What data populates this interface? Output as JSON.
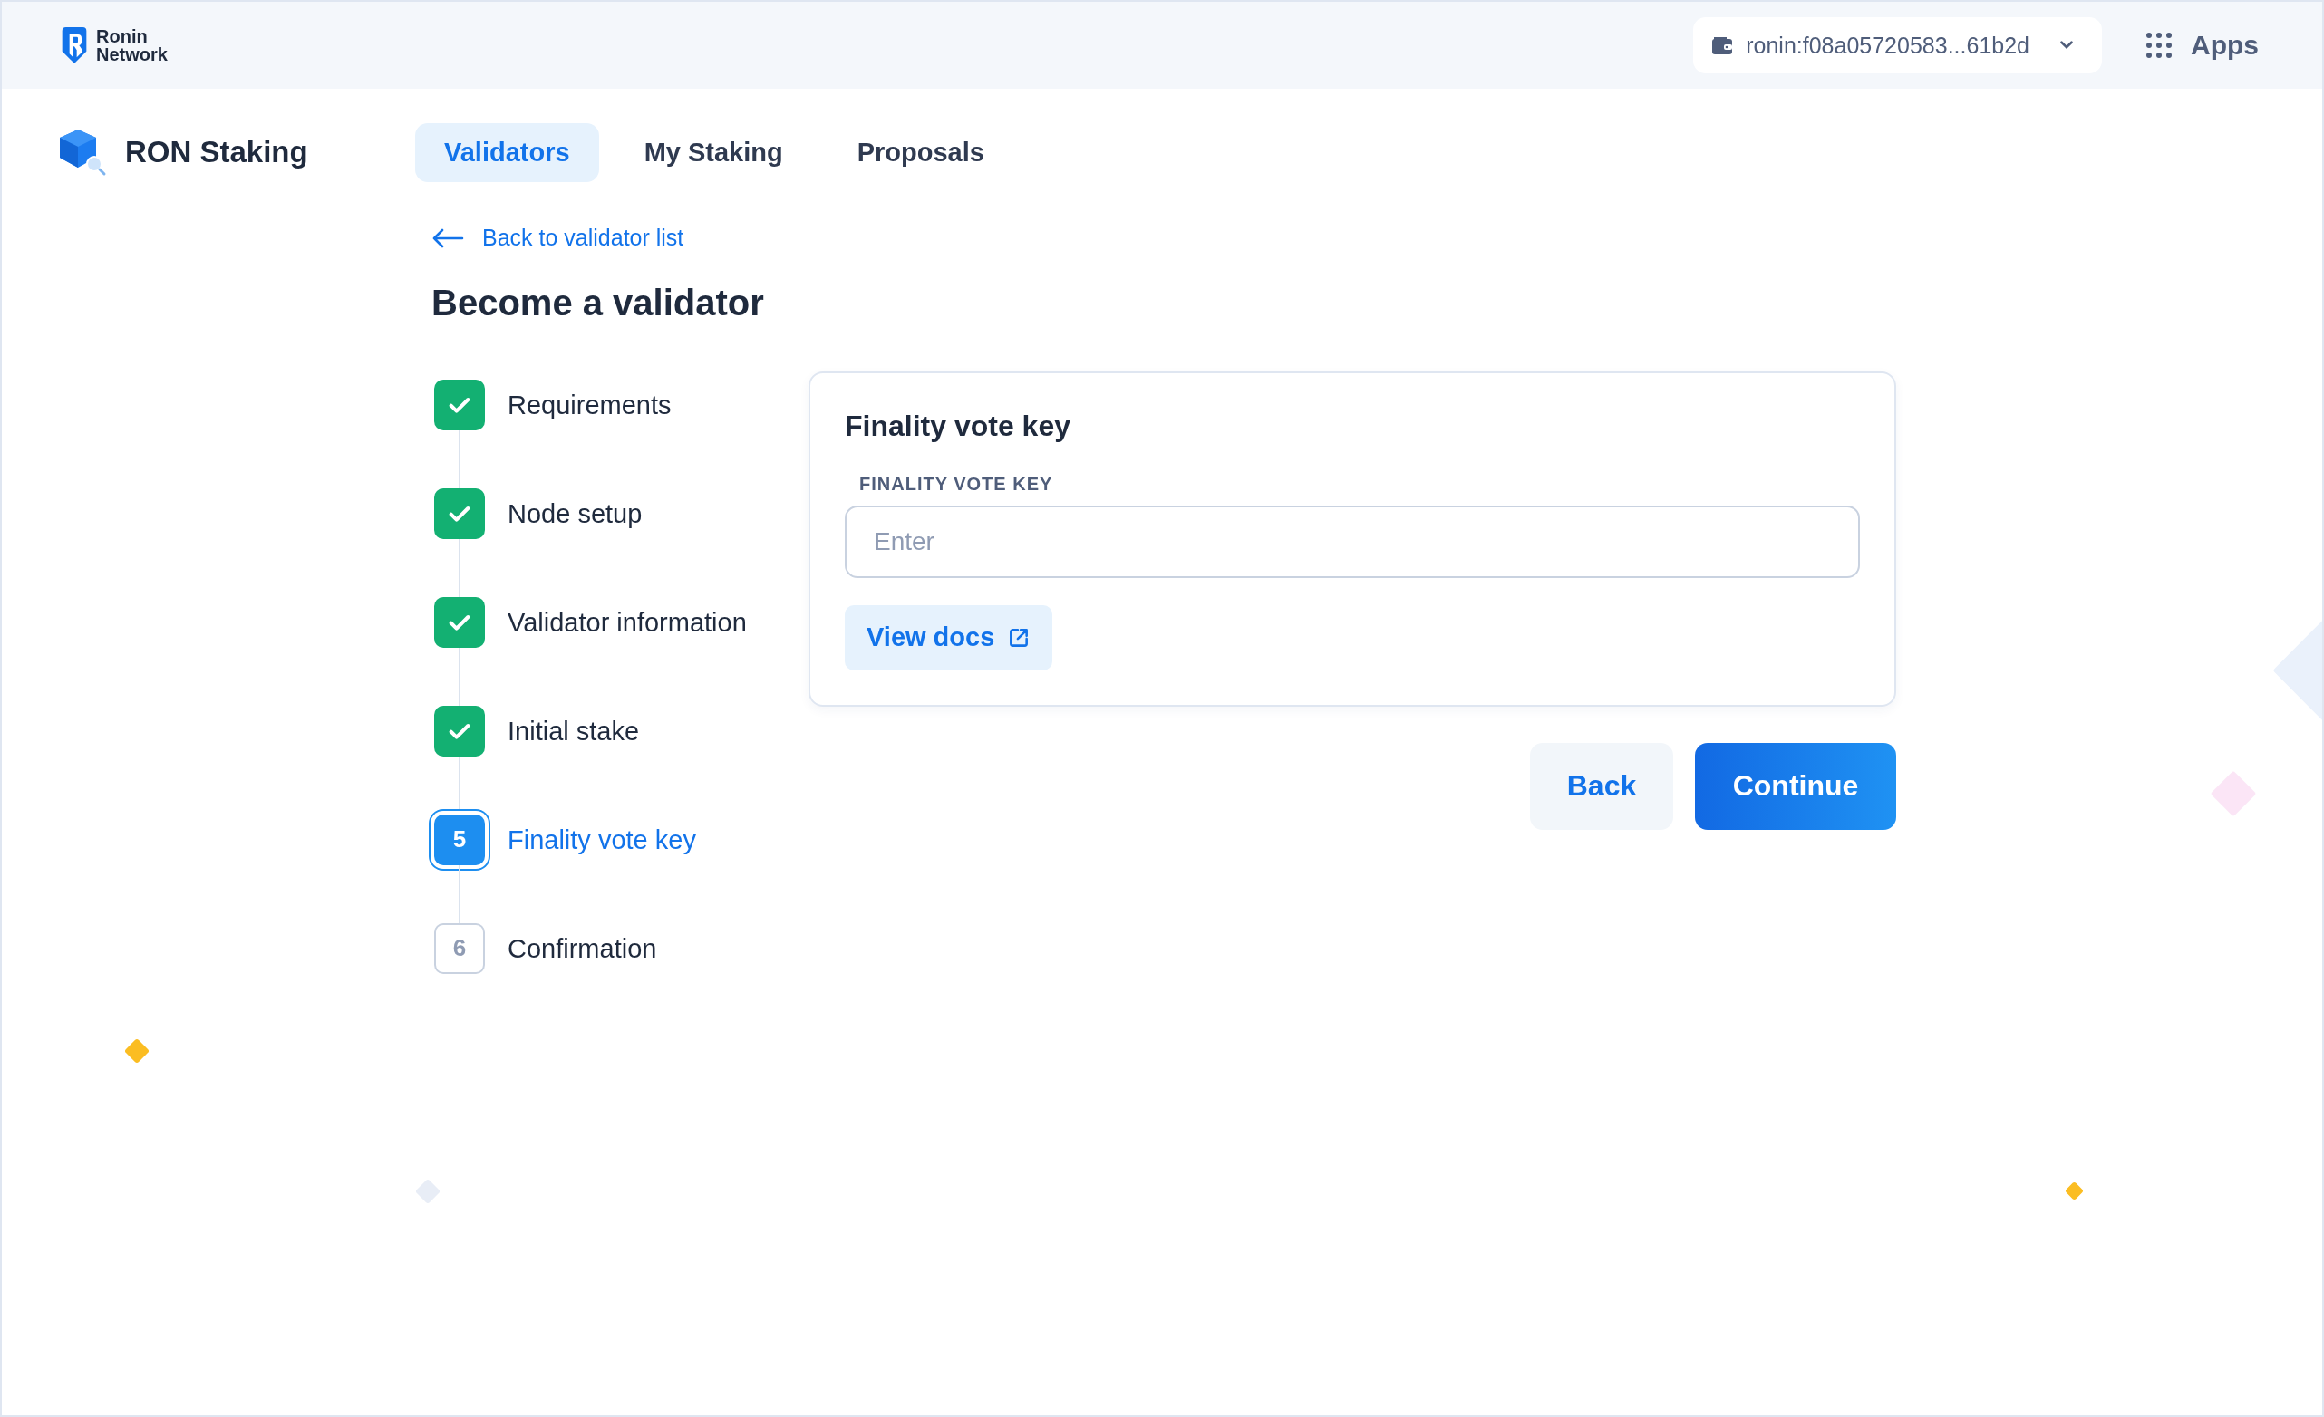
{
  "header": {
    "logo_text": [
      "Ronin",
      "Network"
    ],
    "wallet": "ronin:f08a05720583...61b2d",
    "apps": "Apps"
  },
  "app": {
    "title": "RON Staking",
    "tabs": [
      {
        "label": "Validators",
        "selected": true
      },
      {
        "label": "My Staking",
        "selected": false
      },
      {
        "label": "Proposals",
        "selected": false
      }
    ]
  },
  "back_link": "Back to validator list",
  "page_title": "Become a validator",
  "steps": [
    {
      "label": "Requirements",
      "kind": "done"
    },
    {
      "label": "Node setup",
      "kind": "done"
    },
    {
      "label": "Validator information",
      "kind": "done"
    },
    {
      "label": "Initial stake",
      "kind": "done"
    },
    {
      "number": "5",
      "label": "Finality vote key",
      "kind": "current"
    },
    {
      "number": "6",
      "label": "Confirmation",
      "kind": "pending"
    }
  ],
  "card": {
    "title": "Finality vote key",
    "field_label": "FINALITY VOTE KEY",
    "placeholder": "Enter",
    "docs_button": "View docs"
  },
  "buttons": {
    "back": "Back",
    "continue": "Continue"
  }
}
